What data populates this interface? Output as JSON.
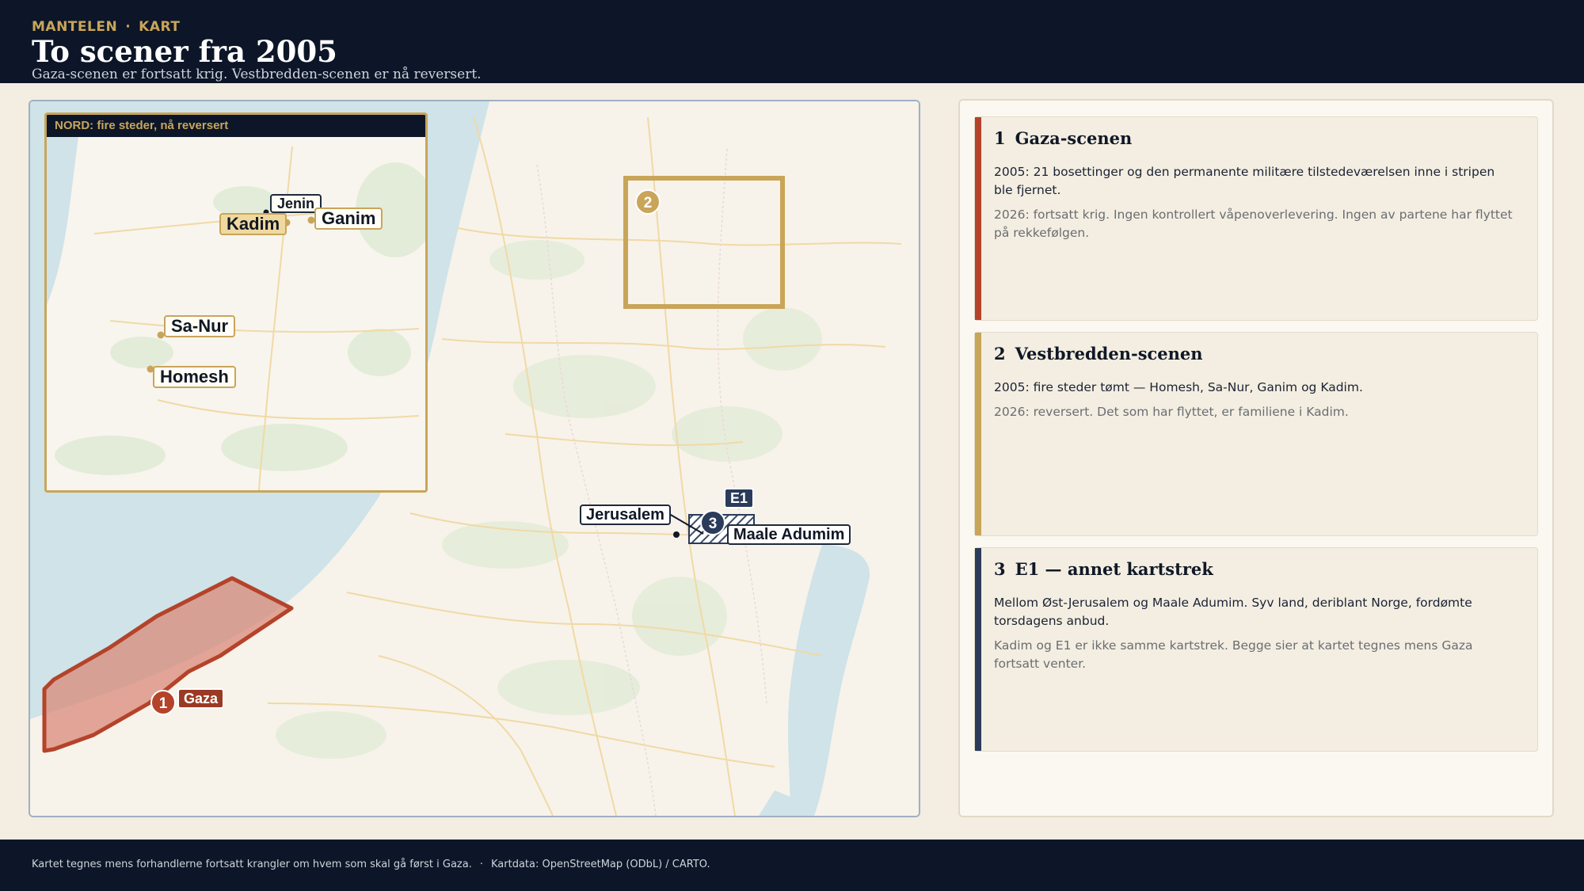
{
  "header": {
    "kicker_left": "MANTELEN",
    "kicker_sep": "·",
    "kicker_right": "KART",
    "title": "To scener fra 2005",
    "subtitle": "Gaza-scenen er fortsatt krig. Vestbredden-scenen er nå reversert."
  },
  "map": {
    "inset": {
      "title": "NORD: fire steder, nå reversert",
      "places": [
        "Jenin",
        "Kadim",
        "Ganim",
        "Sa-Nur",
        "Homesh"
      ]
    },
    "labels": {
      "gaza": "Gaza",
      "jerusalem": "Jerusalem",
      "e1": "E1",
      "maale_adumim": "Maale Adumim"
    },
    "markers": [
      "1",
      "2",
      "3"
    ]
  },
  "cards": [
    {
      "num": "1",
      "title": "Gaza-scenen",
      "text_2005": "2005: 21 bosettinger og den permanente militære tilstedeværelsen inne i stripen ble fjernet.",
      "text_2026": "2026: fortsatt krig. Ingen kontrollert våpenoverlevering. Ingen av partene har flyttet på rekkefølgen.",
      "color": "#b4432a"
    },
    {
      "num": "2",
      "title": "Vestbredden-scenen",
      "text_2005": "2005: fire steder tømt — Homesh, Sa-Nur, Ganim og Kadim.",
      "text_2026": "2026: reversert. Det som har flyttet, er familiene i Kadim.",
      "color": "#c9a55a"
    },
    {
      "num": "3",
      "title": "E1 — annet kartstrek",
      "text_2005": "Mellom Øst-Jerusalem og Maale Adumim. Syv land, deriblant Norge, fordømte torsdagens anbud.",
      "text_2026": "Kadim og E1 er ikke samme kartstrek. Begge sier at kartet tegnes mens Gaza fortsatt venter.",
      "color": "#2b3b5a"
    }
  ],
  "footer": {
    "note": "Kartet tegnes mens forhandlerne fortsatt krangler om hvem som skal gå først i Gaza.",
    "sep": "·",
    "credit": "Kartdata: OpenStreetMap (ODbL) / CARTO."
  },
  "colors": {
    "header_bg": "#0c1628",
    "gold": "#c9a55a",
    "rust": "#b4432a",
    "navy": "#2b3b5a",
    "sea": "#cfe3e8"
  }
}
